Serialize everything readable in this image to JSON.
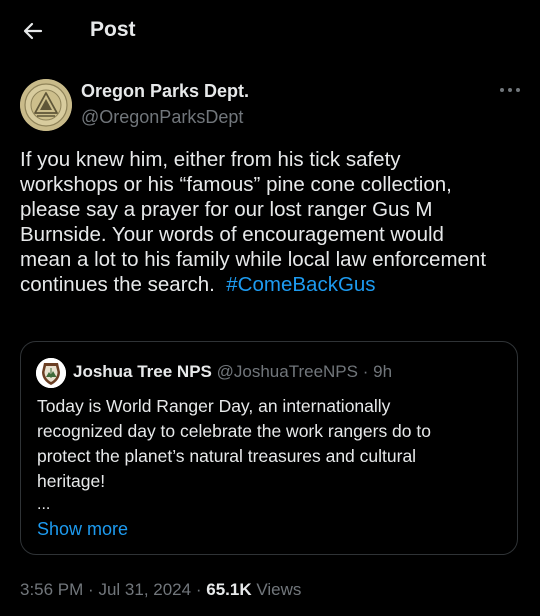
{
  "header": {
    "title": "Post",
    "back_icon": "arrow-left-icon"
  },
  "author": {
    "name": "Oregon Parks Dept.",
    "handle": "@OregonParksDept",
    "avatar_icon": "oregon-parks-seal-icon"
  },
  "more_icon": "more-horizontal-icon",
  "post": {
    "lines": [
      "If you knew him, either from his tick safety",
      "workshops or his “famous” pine cone collection,",
      "please say a prayer for our lost ranger Gus M",
      "Burnside. Your words of encouragement would",
      "mean a lot to his family while local law enforcement"
    ],
    "last_line_text": "continues the search.",
    "hashtag": "#ComeBackGus"
  },
  "quote": {
    "name": "Joshua Tree NPS",
    "handle": "@JoshuaTreeNPS",
    "separator": "·",
    "time": "9h",
    "avatar_icon": "nps-arrowhead-icon",
    "lines": [
      "Today is World Ranger Day, an internationally",
      "recognized day to celebrate the work rangers do to",
      "protect the planet’s natural treasures and cultural",
      "heritage!"
    ],
    "ellipsis": "...",
    "show_more": "Show more"
  },
  "meta": {
    "time": "3:56 PM",
    "separator": "·",
    "date": "Jul 31, 2024",
    "views_count": "65.1K",
    "views_label": "Views"
  },
  "colors": {
    "background": "#000000",
    "text": "#e7e9ea",
    "muted": "#71767b",
    "accent": "#1d9bf0",
    "border": "#2f3336"
  }
}
